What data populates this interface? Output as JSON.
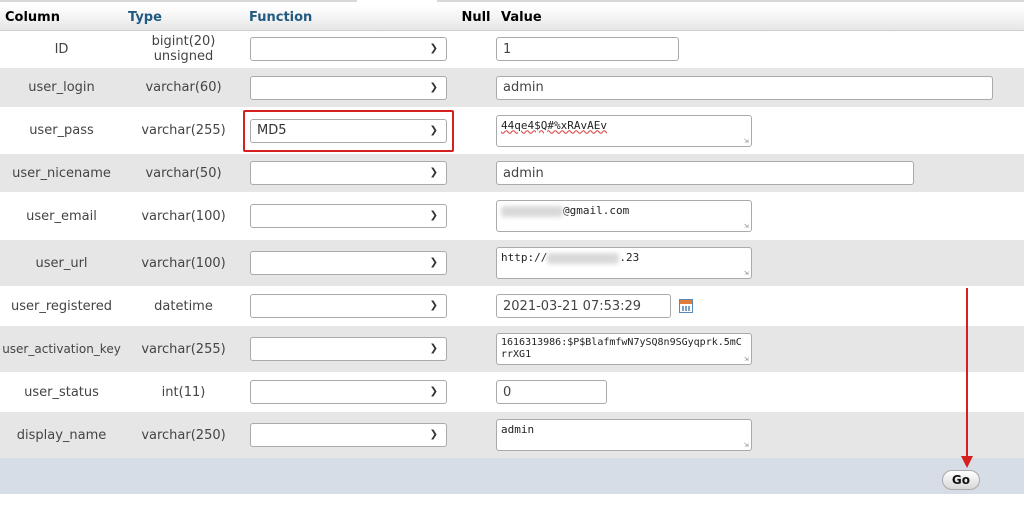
{
  "headers": {
    "column": "Column",
    "type": "Type",
    "function": "Function",
    "null": "Null",
    "value": "Value"
  },
  "rows": [
    {
      "column": "ID",
      "type": "bigint(20) unsigned",
      "function": "",
      "value": "1"
    },
    {
      "column": "user_login",
      "type": "varchar(60)",
      "function": "",
      "value": "admin"
    },
    {
      "column": "user_pass",
      "type": "varchar(255)",
      "function": "MD5",
      "value": "44qe4$Q#%xRAvAEv"
    },
    {
      "column": "user_nicename",
      "type": "varchar(50)",
      "function": "",
      "value": "admin"
    },
    {
      "column": "user_email",
      "type": "varchar(100)",
      "function": "",
      "value_suffix": "@gmail.com"
    },
    {
      "column": "user_url",
      "type": "varchar(100)",
      "function": "",
      "value_prefix": "http://",
      "value_suffix": ".23"
    },
    {
      "column": "user_registered",
      "type": "datetime",
      "function": "",
      "value": "2021-03-21 07:53:29"
    },
    {
      "column": "user_activation_key",
      "type": "varchar(255)",
      "function": "",
      "value": "1616313986:$P$BlafmfwN7ySQ8n9SGyqprk.5mCrrXG1"
    },
    {
      "column": "user_status",
      "type": "int(11)",
      "function": "",
      "value": "0"
    },
    {
      "column": "display_name",
      "type": "varchar(250)",
      "function": "",
      "value": "admin"
    }
  ],
  "go_label": "Go",
  "icons": {
    "dropdown": "chevron-down-icon",
    "calendar": "calendar-icon",
    "annotation": "red-arrow-annotation"
  },
  "colors": {
    "highlight": "#d61f1f",
    "header_blue": "#235a81",
    "row_alt": "#e6e6e6",
    "footer": "#d6dde6"
  }
}
